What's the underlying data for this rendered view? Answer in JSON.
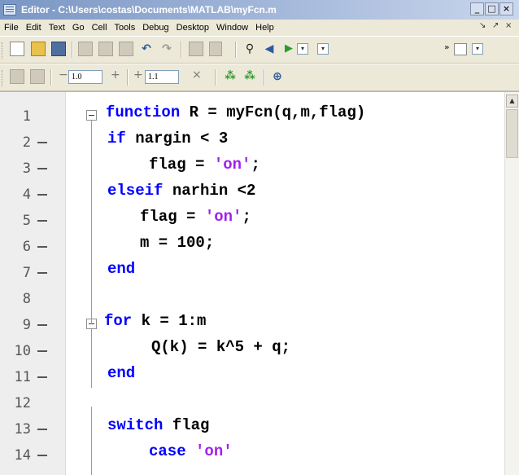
{
  "window": {
    "title": "Editor - C:\\Users\\costas\\Documents\\MATLAB\\myFcn.m",
    "controls": {
      "minimize": "_",
      "restore": "□",
      "close": "×"
    }
  },
  "menubar": {
    "items": [
      "File",
      "Edit",
      "Text",
      "Go",
      "Cell",
      "Tools",
      "Debug",
      "Desktop",
      "Window",
      "Help"
    ],
    "right_controls": {
      "undock": "↘",
      "pin": "↗",
      "close": "×"
    }
  },
  "toolbar": {
    "icons": [
      "new-document-icon",
      "open-folder-icon",
      "save-icon",
      "cut-icon",
      "copy-icon",
      "paste-icon",
      "undo-icon",
      "redo-icon",
      "print-icon",
      "stack-icon",
      "find-icon",
      "back-icon",
      "forward-icon",
      "layout-icon"
    ],
    "overflow": "»"
  },
  "cell_toolbar": {
    "minus": "−",
    "plus": "+",
    "value_1": "1.0",
    "value_2": "1.1",
    "times": "×",
    "icons": [
      "insert-cell-icon",
      "eval-cell-icon",
      "divide-icon",
      "multiply-icon",
      "run-cell-icon",
      "run-advance-icon",
      "zoom-icon"
    ]
  },
  "editor": {
    "colors": {
      "keyword": "#0000ff",
      "string": "#a020f0",
      "code": "#000000"
    },
    "lines": [
      {
        "num": "1",
        "dash": false,
        "tokens": [
          {
            "t": "function",
            "c": "kw"
          },
          {
            "t": " R = myFcn(q,m,flag)",
            "c": ""
          }
        ],
        "indent": 0
      },
      {
        "num": "2",
        "dash": true,
        "tokens": [
          {
            "t": "if",
            "c": "kw"
          },
          {
            "t": " nargin < 3",
            "c": ""
          }
        ],
        "indent": 1
      },
      {
        "num": "3",
        "dash": true,
        "tokens": [
          {
            "t": "flag = ",
            "c": ""
          },
          {
            "t": "'on'",
            "c": "str"
          },
          {
            "t": ";",
            "c": ""
          }
        ],
        "indent": 2
      },
      {
        "num": "4",
        "dash": true,
        "tokens": [
          {
            "t": "elseif",
            "c": "kw"
          },
          {
            "t": " narhin <2",
            "c": ""
          }
        ],
        "indent": 1
      },
      {
        "num": "5",
        "dash": true,
        "tokens": [
          {
            "t": "flag = ",
            "c": ""
          },
          {
            "t": "'on'",
            "c": "str"
          },
          {
            "t": ";",
            "c": ""
          }
        ],
        "indent": 3
      },
      {
        "num": "6",
        "dash": true,
        "tokens": [
          {
            "t": "m = 100;",
            "c": ""
          }
        ],
        "indent": 3
      },
      {
        "num": "7",
        "dash": true,
        "tokens": [
          {
            "t": "end",
            "c": "kw"
          }
        ],
        "indent": 1
      },
      {
        "num": "8",
        "dash": false,
        "tokens": [],
        "indent": 0
      },
      {
        "num": "9",
        "dash": true,
        "tokens": [
          {
            "t": "for",
            "c": "kw"
          },
          {
            "t": " k = 1:m",
            "c": ""
          }
        ],
        "indent": 0
      },
      {
        "num": "10",
        "dash": true,
        "tokens": [
          {
            "t": "Q(k) = k^5 + q;",
            "c": ""
          }
        ],
        "indent": 4
      },
      {
        "num": "11",
        "dash": true,
        "tokens": [
          {
            "t": "end",
            "c": "kw"
          }
        ],
        "indent": 1
      },
      {
        "num": "12",
        "dash": false,
        "tokens": [],
        "indent": 0
      },
      {
        "num": "13",
        "dash": true,
        "tokens": [
          {
            "t": "switch",
            "c": "kw"
          },
          {
            "t": " flag",
            "c": ""
          }
        ],
        "indent": 1
      },
      {
        "num": "14",
        "dash": true,
        "tokens": [
          {
            "t": "case",
            "c": "kw"
          },
          {
            "t": " ",
            "c": ""
          },
          {
            "t": "'on'",
            "c": "str"
          }
        ],
        "indent": 2
      }
    ]
  }
}
